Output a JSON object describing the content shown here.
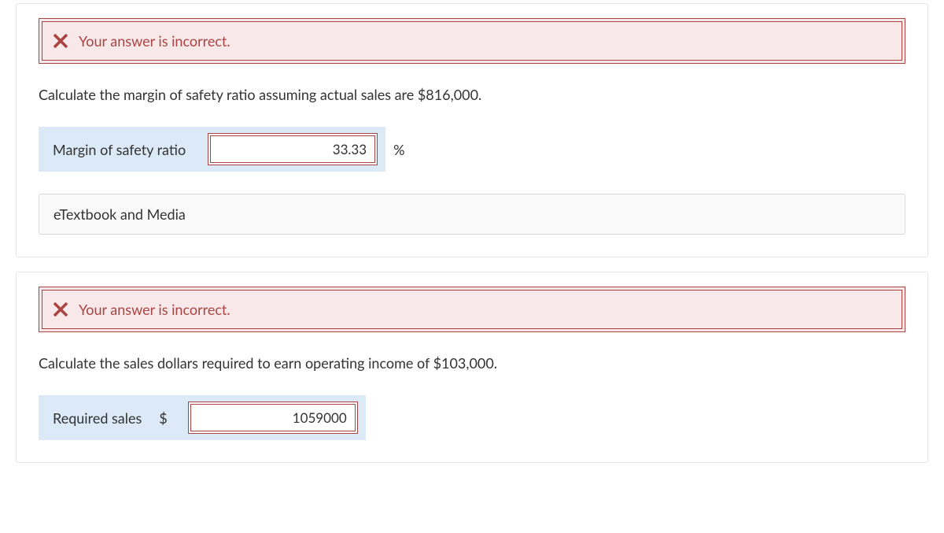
{
  "q1": {
    "alert": "Your answer is incorrect.",
    "question": "Calculate the margin of safety ratio assuming actual sales are $816,000.",
    "label": "Margin of safety ratio",
    "value": "33.33",
    "unit": "%",
    "etextbook": "eTextbook and Media"
  },
  "q2": {
    "alert": "Your answer is incorrect.",
    "question": "Calculate the sales dollars required to earn operating income of $103,000.",
    "label": "Required sales",
    "currency": "$",
    "value": "1059000"
  }
}
